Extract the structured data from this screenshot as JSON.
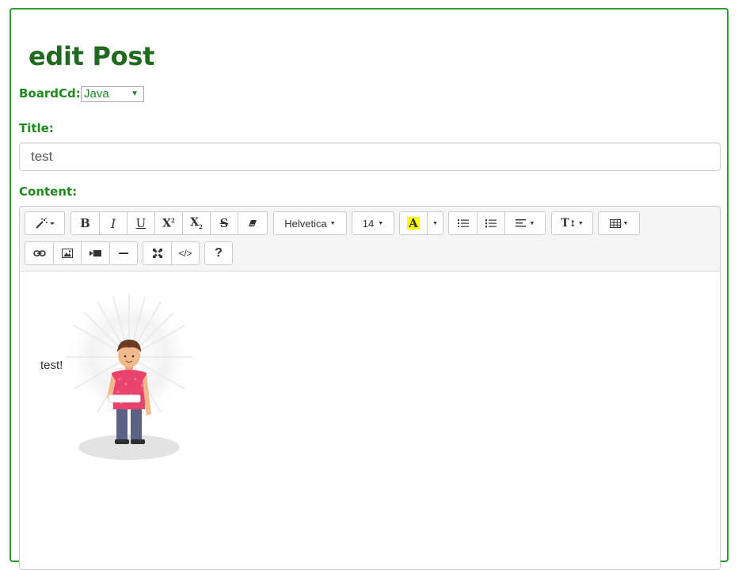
{
  "page": {
    "heading": "edit Post"
  },
  "form": {
    "board_label": "BoardCd:",
    "board_value": "Java",
    "title_label": "Title:",
    "title_value": "test",
    "content_label": "Content:"
  },
  "toolbar": {
    "font_name": "Helvetica",
    "font_size": "14",
    "text_color_letter": "A",
    "style_letter": "T",
    "help_label": "?",
    "code_label": "</>"
  },
  "editor": {
    "content_text": "test!"
  },
  "colors": {
    "heading": "#1f6a1f",
    "label": "#1f8a1f",
    "border": "#2e9b2e",
    "highlight": "#ffff00"
  },
  "icons": [
    "magic-icon",
    "bold-icon",
    "italic-icon",
    "underline-icon",
    "superscript-icon",
    "subscript-icon",
    "strikethrough-icon",
    "eraser-icon",
    "font-color-icon",
    "unordered-list-icon",
    "ordered-list-icon",
    "align-icon",
    "line-height-icon",
    "table-icon",
    "link-icon",
    "picture-icon",
    "video-icon",
    "horizontal-rule-icon",
    "fullscreen-icon",
    "code-view-icon",
    "help-icon"
  ]
}
